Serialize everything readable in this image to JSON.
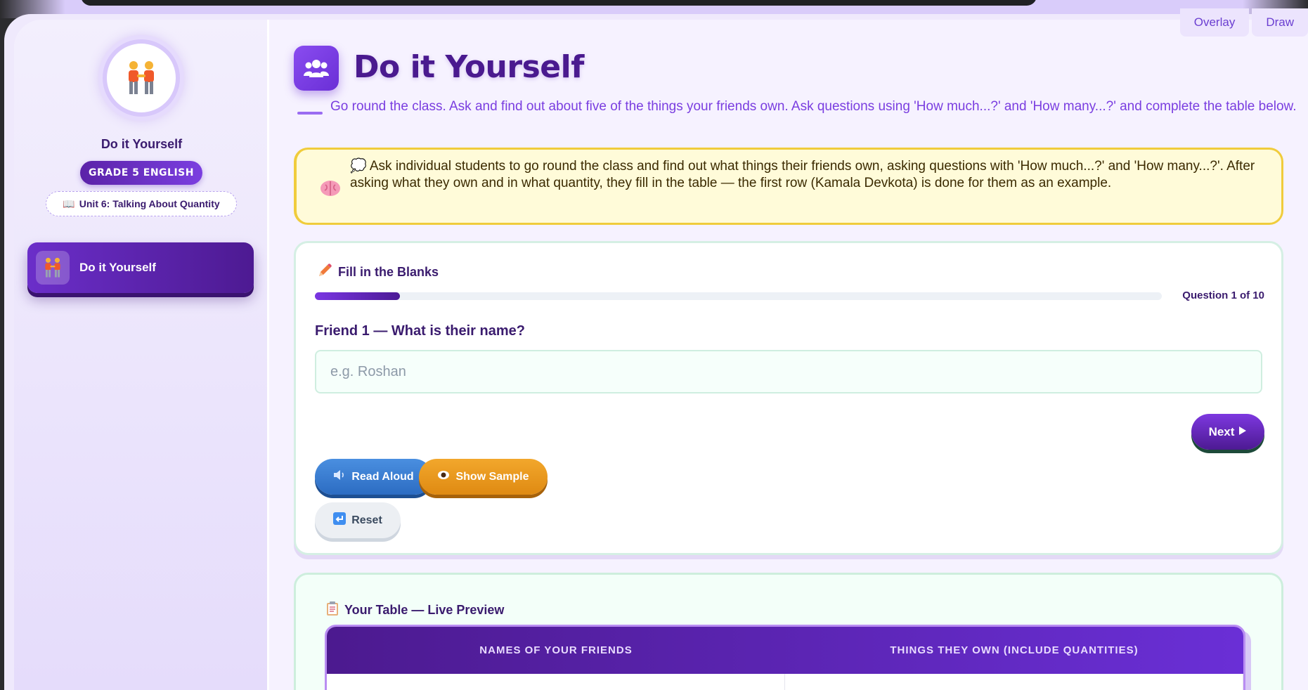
{
  "overlay_tabs": [
    "Overlay",
    "Draw"
  ],
  "sidebar": {
    "title": "Do it Yourself",
    "grade_badge": "GRADE 5 ENGLISH",
    "unit": "Unit 6: Talking About Quantity",
    "nav_items": [
      {
        "label": "Do it Yourself",
        "icon": "people-holding-hands-icon",
        "active": true
      }
    ]
  },
  "main": {
    "title": "Do it Yourself",
    "subtitle": "Go round the class. Ask and find out about five of the things your friends own. Ask questions using 'How much...?' and 'How many...?' and complete the table below.",
    "tip": "💭 Ask individual students to go round the class and find out what things their friends own, asking questions with 'How much...?' and 'How many...?'. After asking what they own and in what quantity, they fill in the table — the first row (Kamala Devkota) is done for them as an example.",
    "exercise": {
      "heading": "Fill in the Blanks",
      "progress_label": "Question 1 of 10",
      "progress_fraction": 0.1,
      "question": "Friend 1 — What is their name?",
      "input_value": "",
      "input_placeholder": "e.g. Roshan",
      "next_label": "Next",
      "read_aloud_label": "Read Aloud",
      "show_sample_label": "Show Sample",
      "reset_label": "Reset"
    },
    "preview": {
      "heading": "Your Table — Live Preview",
      "columns": [
        "NAMES OF YOUR FRIENDS",
        "THINGS THEY OWN (INCLUDE QUANTITIES)"
      ]
    }
  },
  "colors": {
    "accent": "#6a2fd6",
    "tip_background": "#fffbd9",
    "tip_border": "#f0cc3c",
    "read_button": "#2c6cc2",
    "sample_button": "#df8a12"
  }
}
